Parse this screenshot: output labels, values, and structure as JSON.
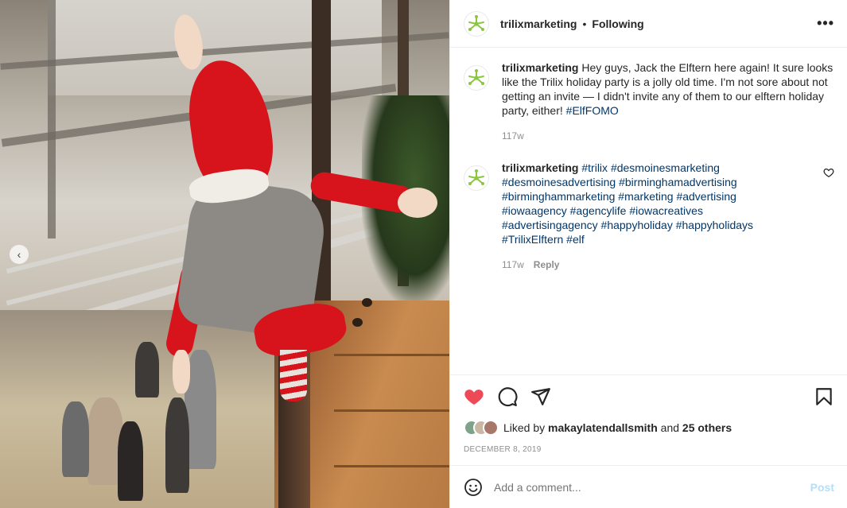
{
  "header": {
    "username": "trilixmarketing",
    "separator": "•",
    "follow_status": "Following",
    "more_label": "•••"
  },
  "caption": {
    "username": "trilixmarketing",
    "text": "Hey guys, Jack the Elftern here again! It sure looks like the Trilix holiday party is a jolly old time. I'm not sore about not getting an invite — I didn't invite any of them to our elftern holiday party, either!",
    "hashtag": "#ElfFOMO",
    "time": "117w"
  },
  "hashtag_comment": {
    "username": "trilixmarketing",
    "tags": [
      "#trilix",
      "#desmoinesmarketing",
      "#desmoinesadvertising",
      "#birminghamadvertising",
      "#birminghammarketing",
      "#marketing",
      "#advertising",
      "#iowaagency",
      "#agencylife",
      "#iowacreatives",
      "#advertisingagency",
      "#happyholiday",
      "#happyholidays",
      "#TrilixElftern",
      "#elf"
    ],
    "time": "117w",
    "reply_label": "Reply",
    "like_icon": "heart-outline-icon"
  },
  "actions": {
    "like_icon": "heart-filled-icon",
    "like_color": "#ed4956",
    "comment_icon": "speech-bubble-icon",
    "share_icon": "paper-plane-icon",
    "save_icon": "bookmark-icon"
  },
  "likes": {
    "prefix": "Liked by",
    "user": "makaylatendallsmith",
    "conjunction": "and",
    "others": "25 others",
    "avatar_colors": [
      "#7fa38a",
      "#c9b7a6",
      "#a7786a"
    ]
  },
  "date": "December 8, 2019",
  "comment_box": {
    "emoji_icon": "smiley-icon",
    "placeholder": "Add a comment...",
    "post_label": "Post",
    "post_color": "#b2dffc"
  },
  "carousel": {
    "prev_icon": "chevron-left-icon",
    "prev_label": "‹"
  },
  "brand": {
    "logo_color": "#8cc63f"
  }
}
